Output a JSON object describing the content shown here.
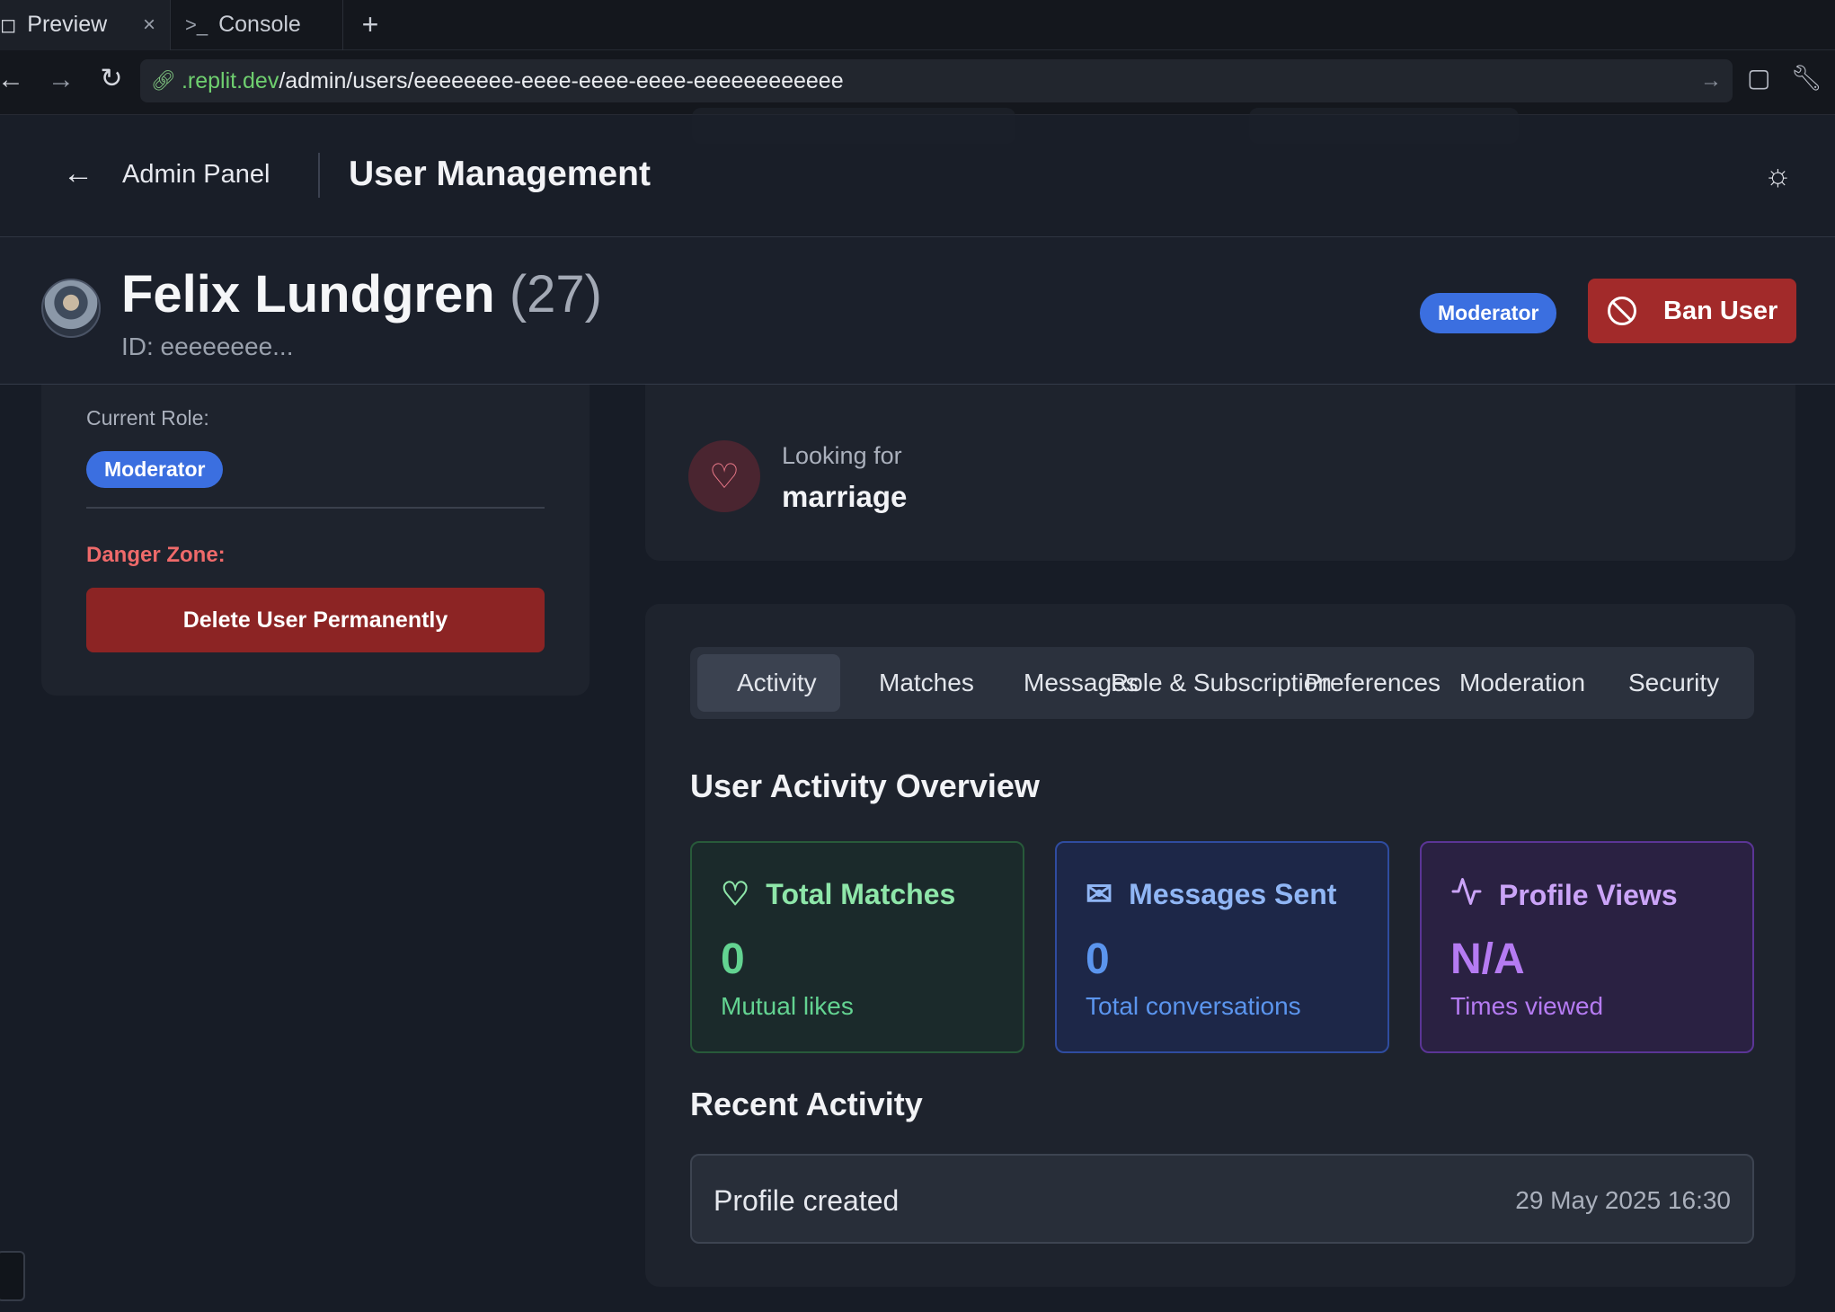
{
  "browser": {
    "tabs": [
      {
        "label": "Preview",
        "icon": "monitor-icon"
      },
      {
        "label": "Console",
        "icon": "terminal-icon"
      }
    ],
    "new_tab": "+",
    "url_host": ".replit.dev",
    "url_path": "/admin/users/eeeeeeee-eeee-eeee-eeee-eeeeeeeeeeee"
  },
  "header": {
    "back_label": "Admin Panel",
    "title": "User Management"
  },
  "profile": {
    "name": "Felix Lundgren",
    "age": "(27)",
    "id": "ID: eeeeeeee...",
    "role_badge": "Moderator",
    "ban_label": "Ban User"
  },
  "left_panel": {
    "current_role_label": "Current Role:",
    "role": "Moderator",
    "danger_label": "Danger Zone:",
    "delete_label": "Delete User Permanently"
  },
  "looking_for": {
    "label": "Looking for",
    "value": "marriage"
  },
  "tabs": [
    {
      "label": "Activity",
      "active": true
    },
    {
      "label": "Matches"
    },
    {
      "label": "Messages"
    },
    {
      "label": "Role & Subscription"
    },
    {
      "label": "Preferences"
    },
    {
      "label": "Moderation"
    },
    {
      "label": "Security"
    }
  ],
  "overview": {
    "title": "User Activity Overview",
    "stats": [
      {
        "title": "Total Matches",
        "value": "0",
        "sub": "Mutual likes",
        "icon": "heart-icon",
        "color": "#63d391"
      },
      {
        "title": "Messages Sent",
        "value": "0",
        "sub": "Total conversations",
        "icon": "mail-icon",
        "color": "#5b95ee"
      },
      {
        "title": "Profile Views",
        "value": "N/A",
        "sub": "Times viewed",
        "icon": "activity-icon",
        "color": "#b57bf2"
      }
    ]
  },
  "recent": {
    "title": "Recent Activity",
    "items": [
      {
        "text": "Profile created",
        "time": "29 May 2025 16:30"
      }
    ]
  },
  "colors": {
    "accent": "#3b6fe0",
    "danger": "#a22a2a"
  }
}
